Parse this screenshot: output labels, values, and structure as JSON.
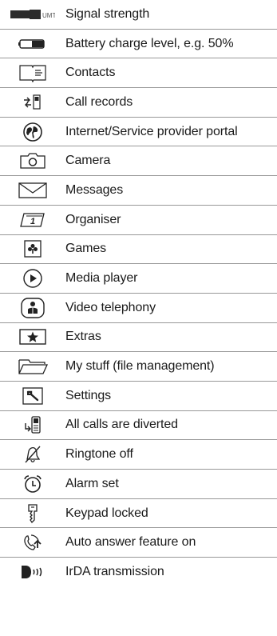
{
  "items": [
    {
      "icon": "signal-strength-icon",
      "label": "Signal strength",
      "icon_text": "UMTS"
    },
    {
      "icon": "battery-icon",
      "label": "Battery charge level, e.g. 50%"
    },
    {
      "icon": "contacts-icon",
      "label": "Contacts"
    },
    {
      "icon": "call-records-icon",
      "label": "Call records"
    },
    {
      "icon": "internet-portal-icon",
      "label": "Internet/Service provider portal"
    },
    {
      "icon": "camera-icon",
      "label": "Camera"
    },
    {
      "icon": "messages-icon",
      "label": "Messages"
    },
    {
      "icon": "organiser-icon",
      "label": "Organiser",
      "icon_text": "1"
    },
    {
      "icon": "games-icon",
      "label": "Games"
    },
    {
      "icon": "media-player-icon",
      "label": "Media player"
    },
    {
      "icon": "video-telephony-icon",
      "label": "Video telephony"
    },
    {
      "icon": "extras-icon",
      "label": "Extras"
    },
    {
      "icon": "my-stuff-icon",
      "label": "My stuff (file management)"
    },
    {
      "icon": "settings-icon",
      "label": "Settings"
    },
    {
      "icon": "call-divert-icon",
      "label": "All calls are diverted"
    },
    {
      "icon": "ringtone-off-icon",
      "label": "Ringtone off"
    },
    {
      "icon": "alarm-icon",
      "label": "Alarm set"
    },
    {
      "icon": "keypad-lock-icon",
      "label": "Keypad locked"
    },
    {
      "icon": "auto-answer-icon",
      "label": "Auto answer feature on"
    },
    {
      "icon": "irda-icon",
      "label": "IrDA transmission"
    }
  ]
}
